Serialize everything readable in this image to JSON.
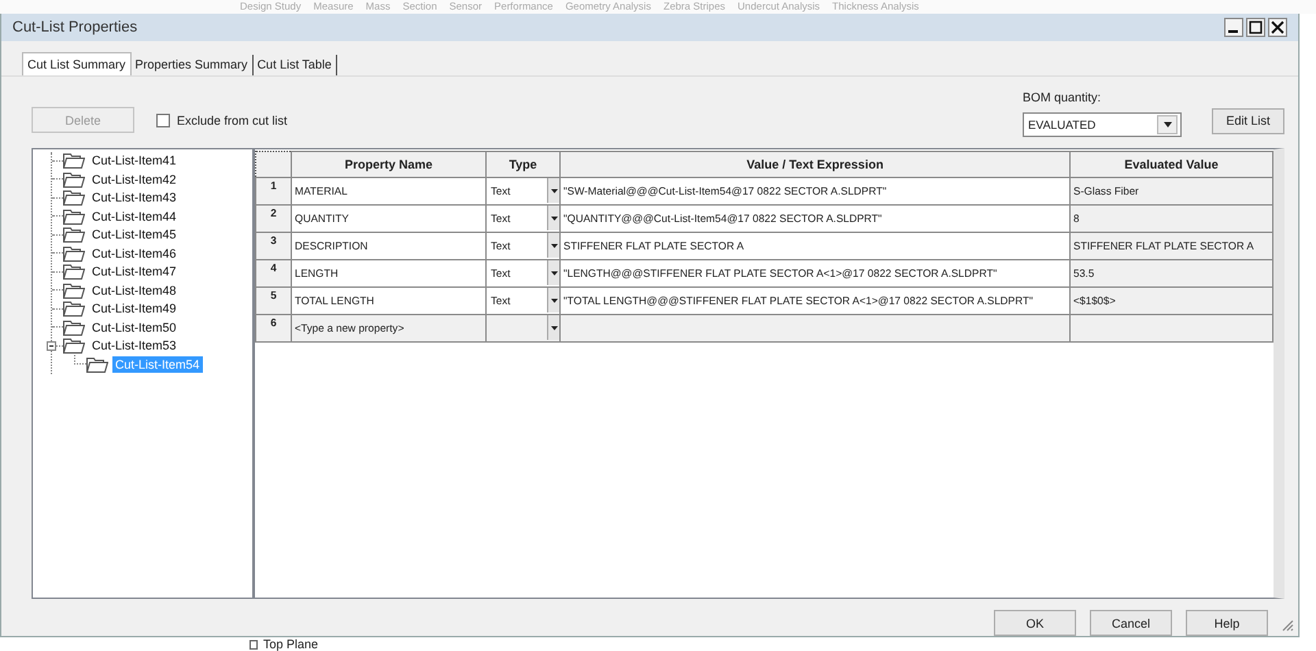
{
  "background": {
    "toolbar_items": [
      "Design Study",
      "Measure",
      "Mass",
      "Section",
      "Sensor",
      "Performance",
      "Geometry Analysis",
      "Zebra Stripes",
      "Undercut Analysis",
      "Thickness Analysis"
    ],
    "tree_item": "Top Plane"
  },
  "window": {
    "title": "Cut-List Properties"
  },
  "tabs": [
    {
      "label": "Cut List Summary",
      "selected": true
    },
    {
      "label": "Properties Summary",
      "selected": false
    },
    {
      "label": "Cut List Table",
      "selected": false
    }
  ],
  "delete_button": {
    "label": "Delete",
    "disabled": true
  },
  "exclude_checkbox": {
    "label": "Exclude from cut list",
    "checked": false
  },
  "bom_quantity": {
    "label": "BOM quantity:",
    "value": "EVALUATED"
  },
  "edit_list_button": "Edit List",
  "tree": {
    "items": [
      {
        "label": "Cut-List-Item41",
        "selected": false
      },
      {
        "label": "Cut-List-Item42",
        "selected": false
      },
      {
        "label": "Cut-List-Item43",
        "selected": false
      },
      {
        "label": "Cut-List-Item44",
        "selected": false
      },
      {
        "label": "Cut-List-Item45",
        "selected": false
      },
      {
        "label": "Cut-List-Item46",
        "selected": false
      },
      {
        "label": "Cut-List-Item47",
        "selected": false
      },
      {
        "label": "Cut-List-Item48",
        "selected": false
      },
      {
        "label": "Cut-List-Item49",
        "selected": false
      },
      {
        "label": "Cut-List-Item50",
        "selected": false
      },
      {
        "label": "Cut-List-Item53",
        "selected": false,
        "expanded": true,
        "children": [
          {
            "label": "Cut-List-Item54",
            "selected": true
          }
        ]
      }
    ]
  },
  "table": {
    "columns": [
      "Property Name",
      "Type",
      "Value / Text Expression",
      "Evaluated Value"
    ],
    "rows": [
      {
        "kind": "property",
        "number": "1",
        "name": "MATERIAL",
        "type": "Text",
        "value": "\"SW-Material@@@Cut-List-Item54@17 0822 SECTOR A.SLDPRT\"",
        "evaluated": "S-Glass Fiber"
      },
      {
        "kind": "property",
        "number": "2",
        "name": "QUANTITY",
        "type": "Text",
        "value": "\"QUANTITY@@@Cut-List-Item54@17 0822 SECTOR A.SLDPRT\"",
        "evaluated": "8"
      },
      {
        "kind": "property",
        "number": "3",
        "name": "DESCRIPTION",
        "type": "Text",
        "value": "STIFFENER FLAT PLATE SECTOR A",
        "evaluated": "STIFFENER FLAT PLATE SECTOR A"
      },
      {
        "kind": "property",
        "number": "4",
        "name": "LENGTH",
        "type": "Text",
        "value": "\"LENGTH@@@STIFFENER FLAT PLATE SECTOR A<1>@17 0822 SECTOR A.SLDPRT\"",
        "evaluated": "53.5"
      },
      {
        "kind": "property",
        "number": "5",
        "name": "TOTAL LENGTH",
        "type": "Text",
        "value": "\"TOTAL LENGTH@@@STIFFENER FLAT PLATE SECTOR A<1>@17 0822 SECTOR A.SLDPRT\"",
        "evaluated": "<$1$0$>"
      },
      {
        "kind": "new",
        "number": "6",
        "placeholder": "<Type a new property>"
      }
    ]
  },
  "buttons": [
    "OK",
    "Cancel",
    "Help"
  ]
}
